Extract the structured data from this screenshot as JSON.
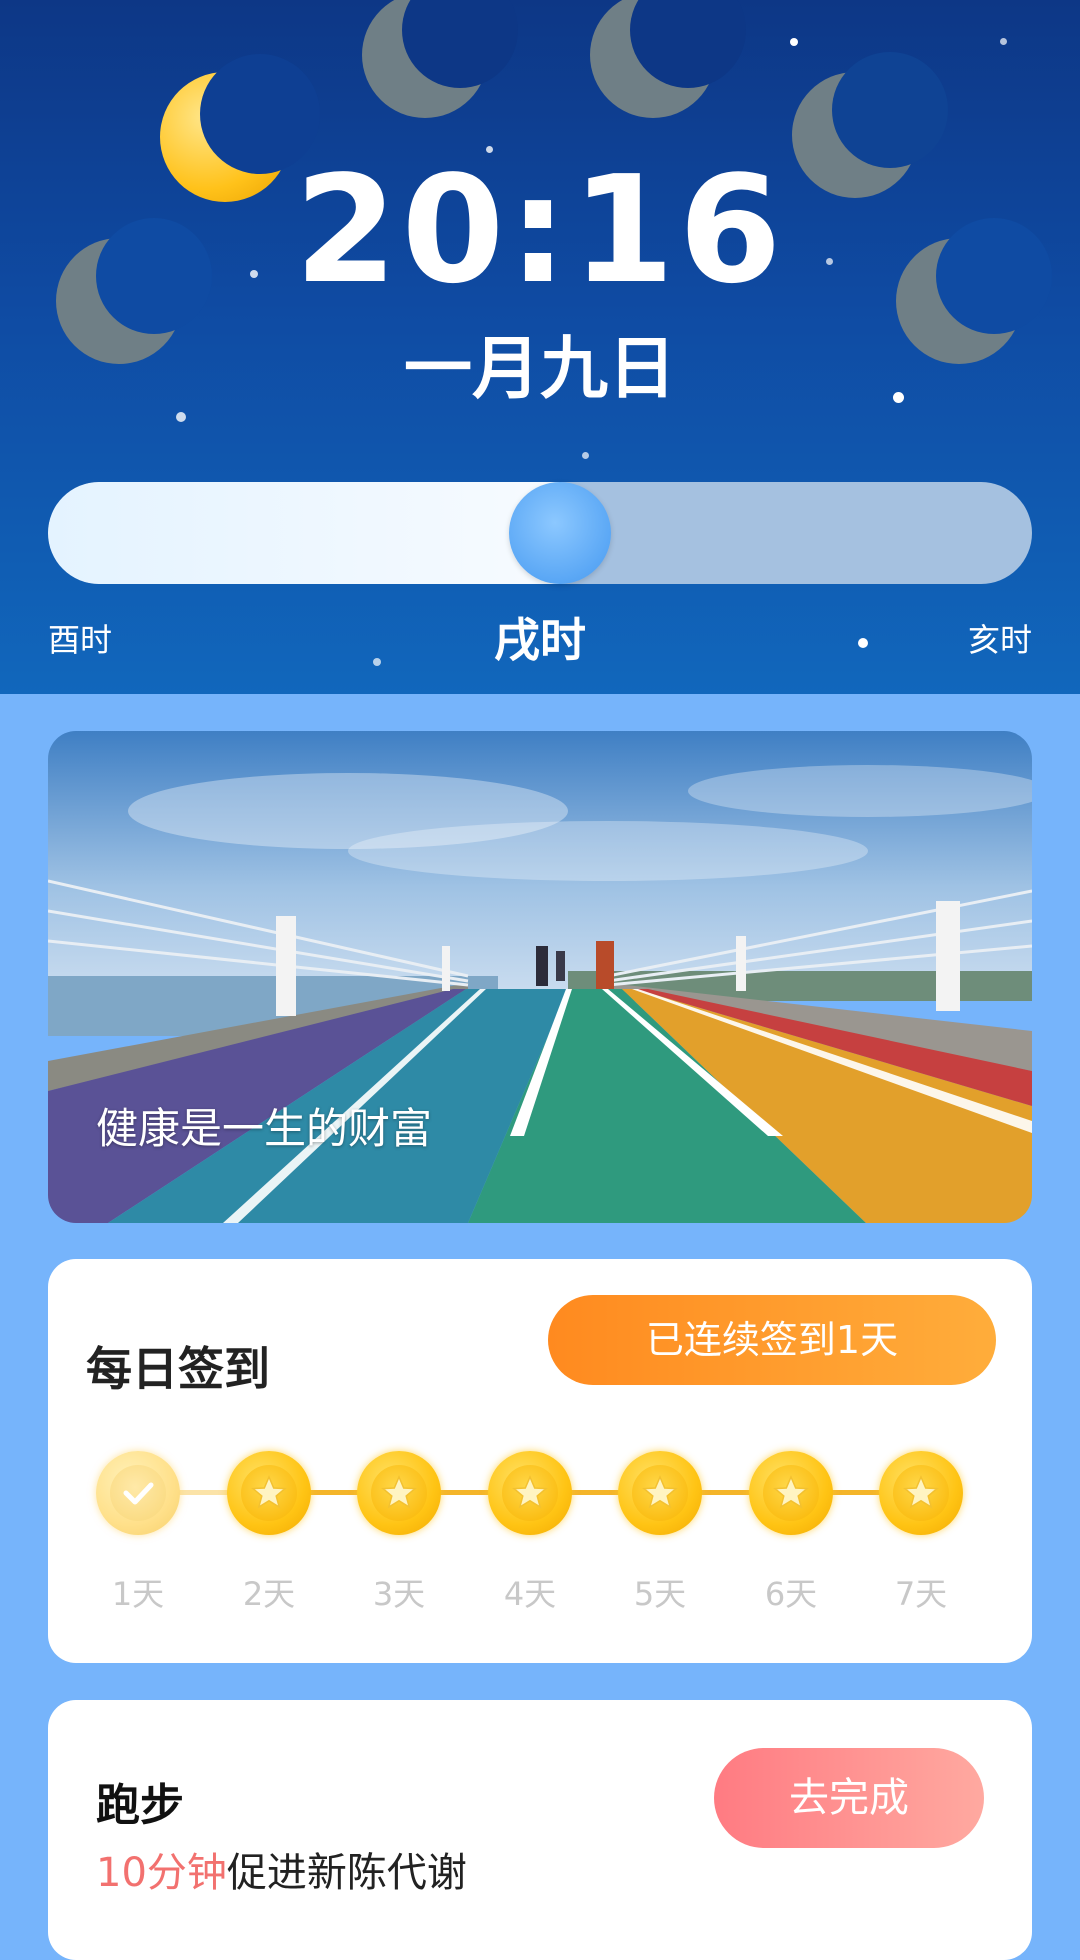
{
  "clock": {
    "time": "20:16",
    "date": "一月九日"
  },
  "shichen": {
    "previous": "酉时",
    "current": "戌时",
    "next": "亥时",
    "progress_percent": 52
  },
  "banner": {
    "caption": "健康是一生的财富"
  },
  "checkin": {
    "title": "每日签到",
    "streak_label": "已连续签到1天",
    "days": [
      {
        "label": "1天",
        "done": true
      },
      {
        "label": "2天",
        "done": false
      },
      {
        "label": "3天",
        "done": false
      },
      {
        "label": "4天",
        "done": false
      },
      {
        "label": "5天",
        "done": false
      },
      {
        "label": "6天",
        "done": false
      },
      {
        "label": "7天",
        "done": false
      }
    ]
  },
  "task": {
    "title": "跑步",
    "desc_highlight": "10分钟",
    "desc_rest": "促进新陈代谢",
    "button_label": "去完成"
  },
  "colors": {
    "background": "#76b4fb",
    "header_top": "#0d3786",
    "streak_button": "#ff8a1f",
    "task_button": "#ff7b82",
    "highlight_text": "#f2716f"
  }
}
